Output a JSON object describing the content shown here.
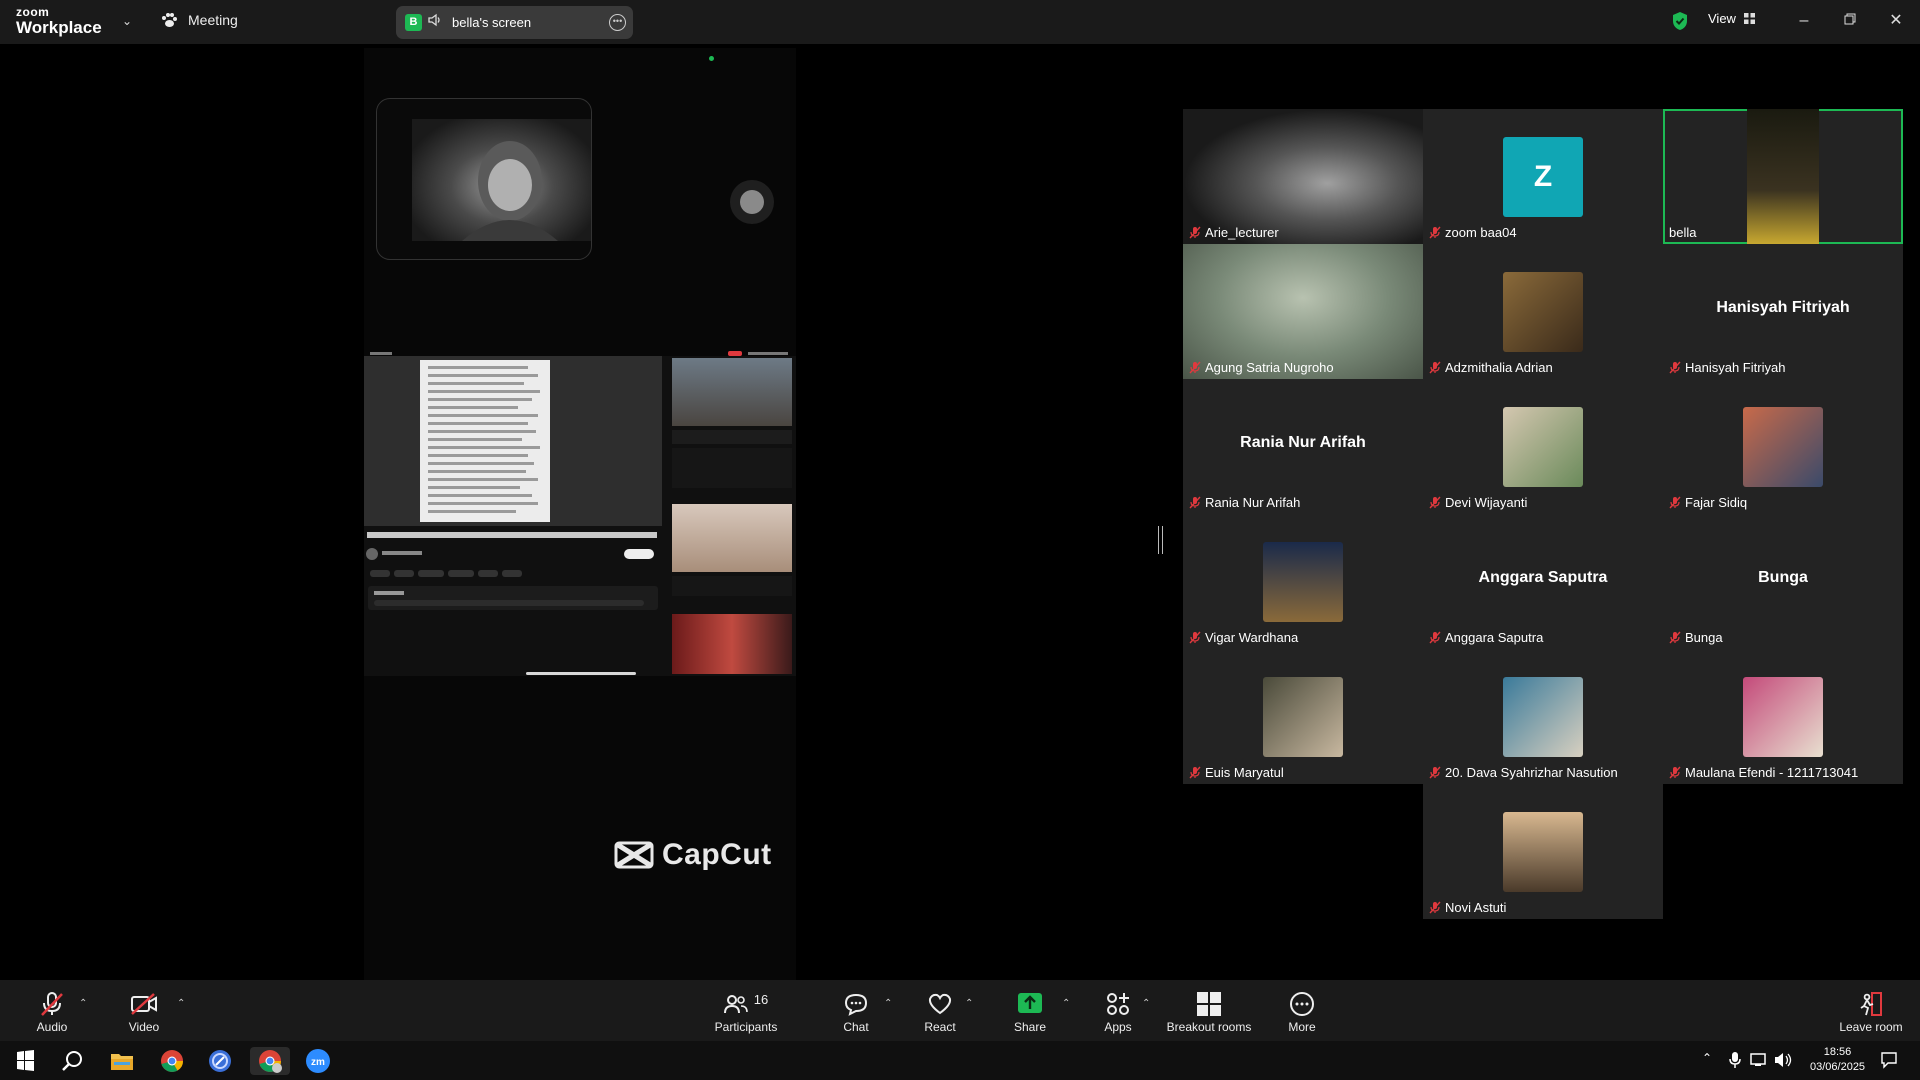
{
  "app": {
    "logo_line1": "zoom",
    "logo_line2": "Workplace"
  },
  "titlebar": {
    "meeting_label": "Meeting",
    "share_badge": "B",
    "share_title": "bella's screen",
    "view_label": "View"
  },
  "shared_screen": {
    "brand": "CapCut"
  },
  "participants": [
    {
      "name": "Arie_lecturer",
      "type": "video",
      "muted": true
    },
    {
      "name": "zoom baa04",
      "type": "letter",
      "letter": "Z",
      "muted": true
    },
    {
      "name": "bella",
      "type": "video",
      "muted": false,
      "active_speaker": true
    },
    {
      "name": "Agung Satria Nugroho",
      "type": "video",
      "muted": true
    },
    {
      "name": "Adzmithalia Adrian",
      "type": "photo",
      "muted": true
    },
    {
      "name": "Hanisyah Fitriyah",
      "type": "name_only",
      "muted": true
    },
    {
      "name": "Rania Nur Arifah",
      "type": "name_only",
      "muted": true
    },
    {
      "name": "Devi Wijayanti",
      "type": "photo",
      "muted": true
    },
    {
      "name": "Fajar Sidiq",
      "type": "photo",
      "muted": true
    },
    {
      "name": "Vigar Wardhana",
      "type": "photo",
      "muted": true
    },
    {
      "name": "Anggara Saputra",
      "type": "name_only",
      "muted": true
    },
    {
      "name": "Bunga",
      "type": "name_only",
      "muted": true
    },
    {
      "name": "Euis Maryatul",
      "type": "photo",
      "muted": true
    },
    {
      "name": "20. Dava Syahrizhar Nasution",
      "type": "photo",
      "muted": true
    },
    {
      "name": "Maulana Efendi - 1211713041",
      "type": "photo",
      "muted": true
    },
    {
      "name": "Novi Astuti",
      "type": "photo",
      "muted": true
    }
  ],
  "toolbar": {
    "audio": "Audio",
    "video": "Video",
    "participants": "Participants",
    "participants_count": "16",
    "chat": "Chat",
    "react": "React",
    "share": "Share",
    "apps": "Apps",
    "breakout": "Breakout rooms",
    "more": "More",
    "leave": "Leave room"
  },
  "taskbar": {
    "time": "18:56",
    "date": "03/06/2025"
  },
  "colors": {
    "accent_green": "#1db954",
    "muted_red": "#e0393e",
    "toolbar_bg": "#1a1a1a"
  }
}
